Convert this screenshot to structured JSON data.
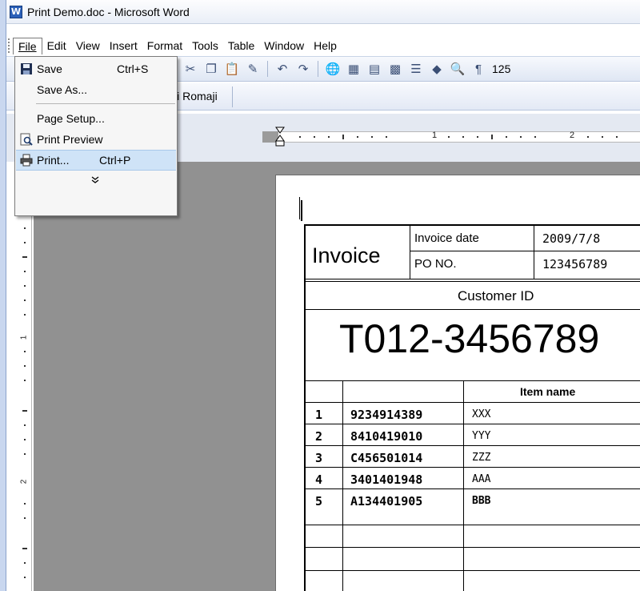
{
  "window": {
    "title": "Print Demo.doc - Microsoft Word",
    "app_icon": "W"
  },
  "menubar": {
    "items": [
      "File",
      "Edit",
      "View",
      "Insert",
      "Format",
      "Tools",
      "Table",
      "Window",
      "Help"
    ]
  },
  "toolbar": {
    "zoom": "125"
  },
  "toolbar2": {
    "label": "ji Romaji"
  },
  "ruler": {
    "numbers": [
      "1",
      "2"
    ]
  },
  "vruler": {
    "numbers": [
      "1",
      "2"
    ]
  },
  "file_menu": {
    "save_label": "Save",
    "save_shortcut": "Ctrl+S",
    "save_as_label": "Save As...",
    "page_setup_label": "Page Setup...",
    "print_preview_label": "Print Preview",
    "print_label": "Print...",
    "print_shortcut": "Ctrl+P",
    "expand_glyph": "¥"
  },
  "invoice": {
    "title": "Invoice",
    "invoice_date_label": "Invoice date",
    "invoice_date_value": "2009/7/8",
    "po_label": "PO NO.",
    "po_value": "123456789",
    "customer_id_label": "Customer ID",
    "customer_id_value": "T012-3456789",
    "item_name_header": "Item name",
    "rows": [
      {
        "no": "1",
        "code": "9234914389",
        "name": "XXX"
      },
      {
        "no": "2",
        "code": "8410419010",
        "name": "YYY"
      },
      {
        "no": "3",
        "code": "C456501014",
        "name": "ZZZ"
      },
      {
        "no": "4",
        "code": "3401401948",
        "name": "AAA"
      },
      {
        "no": "5",
        "code": "A134401905",
        "name": "BBB"
      }
    ]
  }
}
